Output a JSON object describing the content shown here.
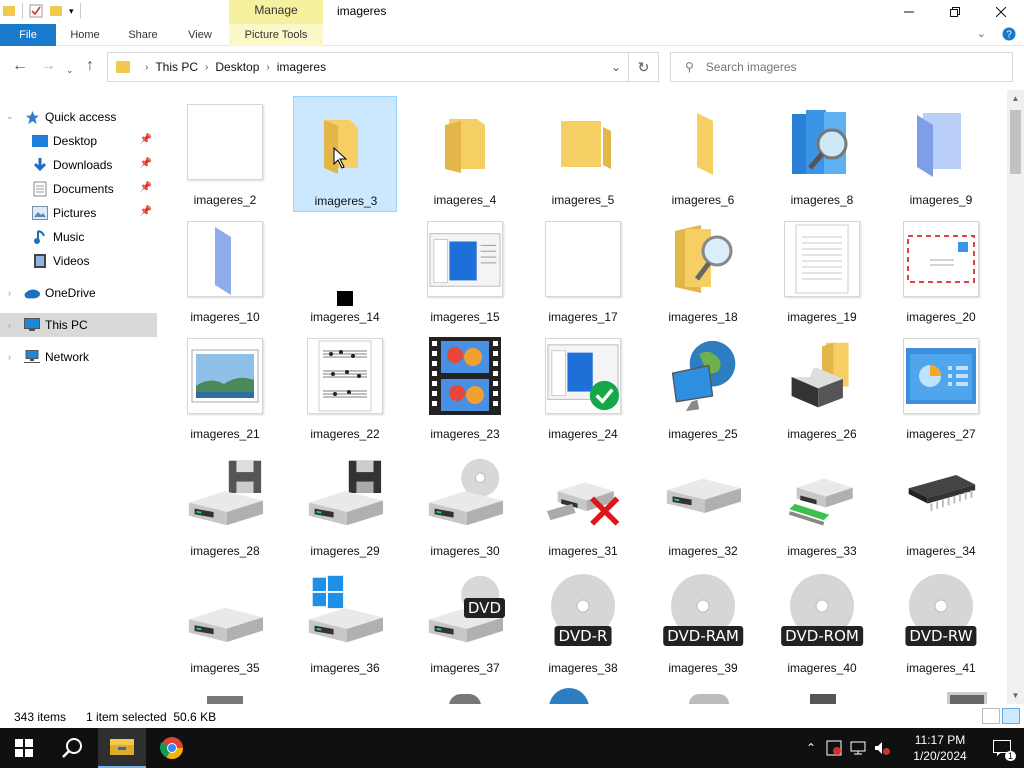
{
  "window": {
    "title": "imageres",
    "manage_label": "Manage",
    "controls": {
      "minimize": "—",
      "maximize": "❐",
      "close": "✕"
    }
  },
  "ribbon": {
    "tabs": [
      {
        "label": "File"
      },
      {
        "label": "Home"
      },
      {
        "label": "Share"
      },
      {
        "label": "View"
      },
      {
        "label": "Picture Tools"
      }
    ],
    "collapse_icon": "chevron-down",
    "help_icon": "?"
  },
  "address": {
    "crumbs": [
      "This PC",
      "Desktop",
      "imageres"
    ],
    "search_placeholder": "Search imageres"
  },
  "sidebar": {
    "items": [
      {
        "label": "Quick access",
        "icon": "star-icon"
      },
      {
        "label": "Desktop",
        "icon": "desktop-icon",
        "pinned": true
      },
      {
        "label": "Downloads",
        "icon": "download-icon",
        "pinned": true
      },
      {
        "label": "Documents",
        "icon": "documents-icon",
        "pinned": true
      },
      {
        "label": "Pictures",
        "icon": "pictures-icon",
        "pinned": true
      },
      {
        "label": "Music",
        "icon": "music-icon"
      },
      {
        "label": "Videos",
        "icon": "videos-icon"
      },
      {
        "label": "OneDrive",
        "icon": "cloud-icon"
      },
      {
        "label": "This PC",
        "icon": "pc-icon",
        "selected": true
      },
      {
        "label": "Network",
        "icon": "network-icon"
      }
    ]
  },
  "files": [
    {
      "name": "imageres_2",
      "icon": "blank-doc"
    },
    {
      "name": "imageres_3",
      "icon": "folder-open",
      "selected": true
    },
    {
      "name": "imageres_4",
      "icon": "folder"
    },
    {
      "name": "imageres_5",
      "icon": "folder-closed"
    },
    {
      "name": "imageres_6",
      "icon": "folder-thin"
    },
    {
      "name": "imageres_8",
      "icon": "library-search"
    },
    {
      "name": "imageres_9",
      "icon": "folder-blue"
    },
    {
      "name": "imageres_10",
      "icon": "folder-blue-thin"
    },
    {
      "name": "imageres_14",
      "icon": "black-square"
    },
    {
      "name": "imageres_15",
      "icon": "window-app"
    },
    {
      "name": "imageres_17",
      "icon": "blank-white"
    },
    {
      "name": "imageres_18",
      "icon": "folder-search"
    },
    {
      "name": "imageres_19",
      "icon": "text-doc"
    },
    {
      "name": "imageres_20",
      "icon": "envelope"
    },
    {
      "name": "imageres_21",
      "icon": "landscape-image"
    },
    {
      "name": "imageres_22",
      "icon": "sheet-music"
    },
    {
      "name": "imageres_23",
      "icon": "film-strip"
    },
    {
      "name": "imageres_24",
      "icon": "window-check"
    },
    {
      "name": "imageres_25",
      "icon": "globe-monitor"
    },
    {
      "name": "imageres_26",
      "icon": "printer-folder"
    },
    {
      "name": "imageres_27",
      "icon": "control-panel"
    },
    {
      "name": "imageres_28",
      "icon": "drive-floppy"
    },
    {
      "name": "imageres_29",
      "icon": "drive-floppy-dark"
    },
    {
      "name": "imageres_30",
      "icon": "drive-cd"
    },
    {
      "name": "imageres_31",
      "icon": "drive-network-x"
    },
    {
      "name": "imageres_32",
      "icon": "drive"
    },
    {
      "name": "imageres_33",
      "icon": "drive-network"
    },
    {
      "name": "imageres_34",
      "icon": "chip"
    },
    {
      "name": "imageres_35",
      "icon": "drive-plain"
    },
    {
      "name": "imageres_36",
      "icon": "drive-windows"
    },
    {
      "name": "imageres_37",
      "icon": "drive-dvd",
      "badge": "DVD"
    },
    {
      "name": "imageres_38",
      "icon": "disc",
      "badge": "DVD-R"
    },
    {
      "name": "imageres_39",
      "icon": "disc",
      "badge": "DVD-RAM"
    },
    {
      "name": "imageres_40",
      "icon": "disc",
      "badge": "DVD-ROM"
    },
    {
      "name": "imageres_41",
      "icon": "disc",
      "badge": "DVD-RW"
    }
  ],
  "status": {
    "count": "343 items",
    "selection": "1 item selected  50.6 KB"
  },
  "taskbar": {
    "time": "11:17 PM",
    "date": "1/20/2024",
    "notifications": "1"
  },
  "colors": {
    "accent": "#1979ca",
    "selection_bg": "#cce8ff",
    "selection_border": "#99d1ff",
    "folder": "#f2c94c",
    "manage_bg": "#f6f19f"
  }
}
